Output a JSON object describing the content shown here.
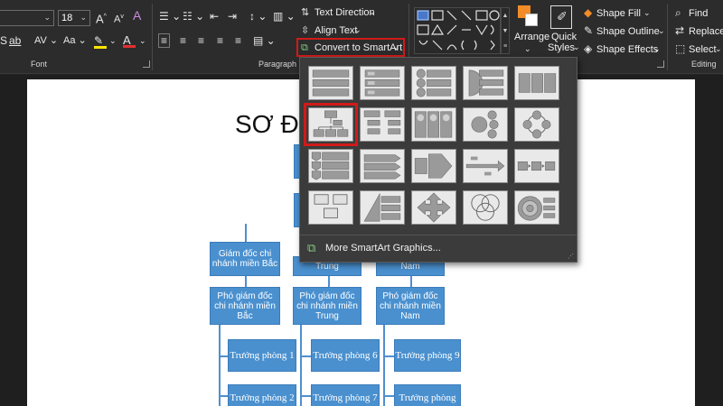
{
  "font": {
    "size": "18",
    "group_label": "Font"
  },
  "paragraph": {
    "group_label": "Paragraph",
    "text_direction": "Text Direction",
    "align_text": "Align Text",
    "convert_smartart": "Convert to SmartArt"
  },
  "drawing": {
    "arrange": "Arrange",
    "quick_styles_line1": "Quick",
    "quick_styles_line2": "Styles",
    "shape_fill": "Shape Fill",
    "shape_outline": "Shape Outline",
    "shape_effects": "Shape Effects"
  },
  "editing": {
    "group_label": "Editing",
    "find": "Find",
    "replace": "Replace",
    "select": "Select"
  },
  "smartart_panel": {
    "more_graphics": "More SmartArt Graphics..."
  },
  "slide": {
    "title": "SƠ Đ",
    "boxes": {
      "gd_bac": [
        "Giám đốc chi",
        "nhánh miền Bắc"
      ],
      "gd_trung_tail": "Trung",
      "gd_nam_tail": "Nam",
      "pgd_bac": [
        "Phó giám đốc",
        "chi nhánh miền",
        "Bắc"
      ],
      "pgd_trung": [
        "Phó giám đốc",
        "chi nhánh miền",
        "Trung"
      ],
      "pgd_nam": [
        "Phó giám đốc",
        "chi nhánh miền",
        "Nam"
      ],
      "tp1": "Trưởng phòng 1",
      "tp2": "Trưởng phòng 2",
      "tp6": "Trưởng phòng 6",
      "tp7": "Trưởng phòng 7",
      "tp9": "Trưởng phòng 9",
      "tp10": "Trưởng phòng"
    }
  },
  "colors": {
    "org_box": "#4a90cf",
    "highlight": "#d11a1a",
    "ribbon": "#2c2c2c"
  }
}
